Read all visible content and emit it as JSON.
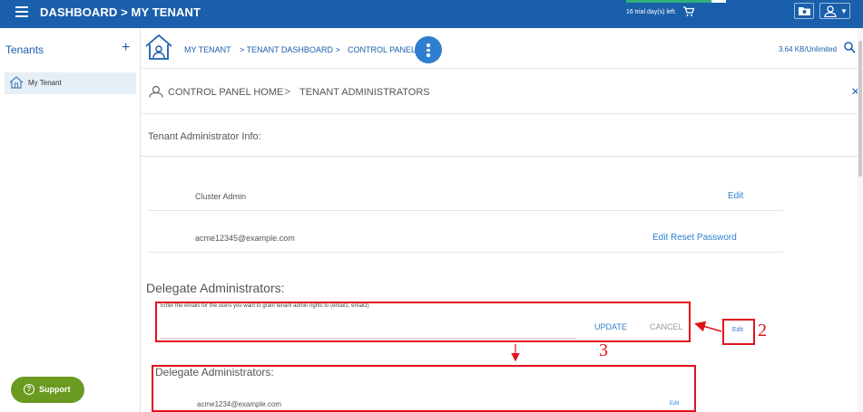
{
  "header": {
    "title": "DASHBOARD > MY TENANT",
    "trial_text": "16 trial day(s) left.",
    "trial_progress": 0.85,
    "icons": [
      "menu-icon",
      "cart-icon",
      "folder-icon",
      "user-icon"
    ]
  },
  "sidebar": {
    "title": "Tenants",
    "add_label": "+",
    "items": [
      {
        "label": "My Tenant",
        "icon": "home-icon"
      }
    ],
    "support_label": "Support"
  },
  "breadcrumb": {
    "items": [
      "MY TENANT",
      "> TENANT DASHBOARD >",
      "CONTROL PANEL"
    ],
    "usage": "3.64 KB/Unlimited"
  },
  "sub_header": {
    "home": "CONTROL PANEL HOME",
    "separator": ">",
    "current": "TENANT ADMINISTRATORS",
    "close_label": "×"
  },
  "tenant_admin": {
    "title": "Tenant Administrator Info:",
    "rows": [
      {
        "name": "Cluster Admin",
        "action": "Edit"
      },
      {
        "name": "acme12345@example.com",
        "action": "Edit Reset Password"
      }
    ]
  },
  "delegate": {
    "title": "Delegate Administrators:",
    "hint": "Enter the emails for the users you want to grant tenant admin rights to (email1; email2)",
    "input_value": "",
    "update_label": "UPDATE",
    "cancel_label": "CANCEL",
    "edit_label": "Edit"
  },
  "result": {
    "title": "Delegate Administrators:",
    "email": "acme1234@example.com",
    "edit_label": "Edit"
  },
  "annotations": {
    "step_2": "2",
    "step_3": "3",
    "color": "#e2121b"
  },
  "colors": {
    "topbar": "#1a5fab",
    "link": "#2f7fd0",
    "support": "#6a9a1f"
  }
}
